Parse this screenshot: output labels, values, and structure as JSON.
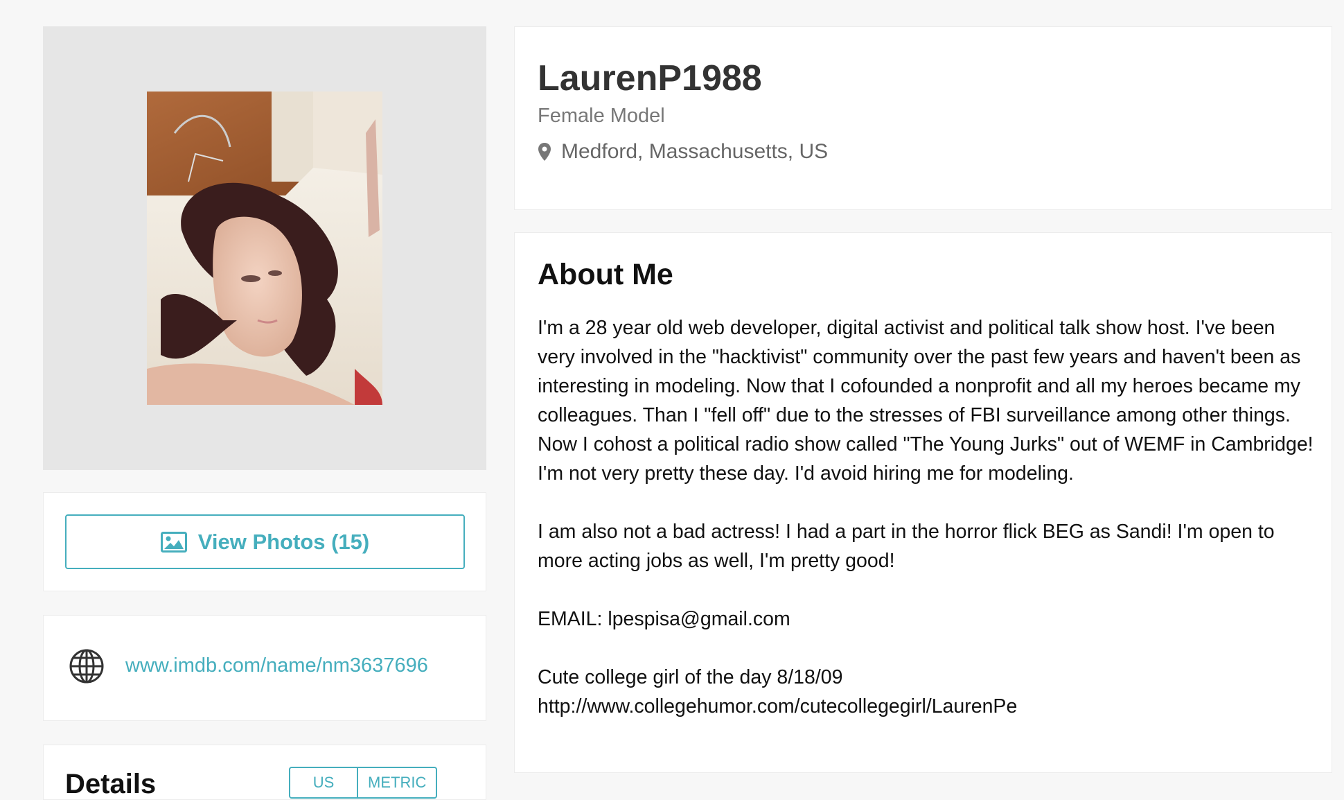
{
  "profile": {
    "username": "LaurenP1988",
    "role": "Female Model",
    "location": "Medford, Massachusetts, US",
    "location_icon": "map-pin-icon"
  },
  "photo": {
    "alt": "profile photo"
  },
  "actions": {
    "view_photos_label": "View Photos (15)",
    "view_photos_icon": "image-icon"
  },
  "website": {
    "icon": "globe-icon",
    "url_text": "www.imdb.com/name/nm3637696"
  },
  "details": {
    "title": "Details",
    "units": [
      "US",
      "METRIC"
    ]
  },
  "about": {
    "title": "About Me",
    "paragraphs": [
      "I'm a 28 year old web developer, digital activist and political talk show host. I've been very involved in the \"hacktivist\" community over the past few years and haven't been as interesting in modeling. Now that I cofounded a nonprofit and all my heroes became my colleagues. Than I \"fell off\" due to the stresses of FBI surveillance among other things. Now I cohost a political radio show called \"The Young Jurks\" out of WEMF in Cambridge! I'm not very pretty these day. I'd avoid hiring me for modeling.",
      "I am also not a bad actress! I had a part in the horror flick BEG as Sandi! I'm open to more acting jobs as well, I'm pretty good!",
      "EMAIL: lpespisa@gmail.com",
      "Cute college girl of the day 8/18/09\nhttp://www.collegehumor.com/cutecollegegirl/LaurenPe"
    ]
  },
  "colors": {
    "accent": "#45aebd",
    "page_bg": "#f7f7f7",
    "photo_bg": "#e6e6e6"
  }
}
